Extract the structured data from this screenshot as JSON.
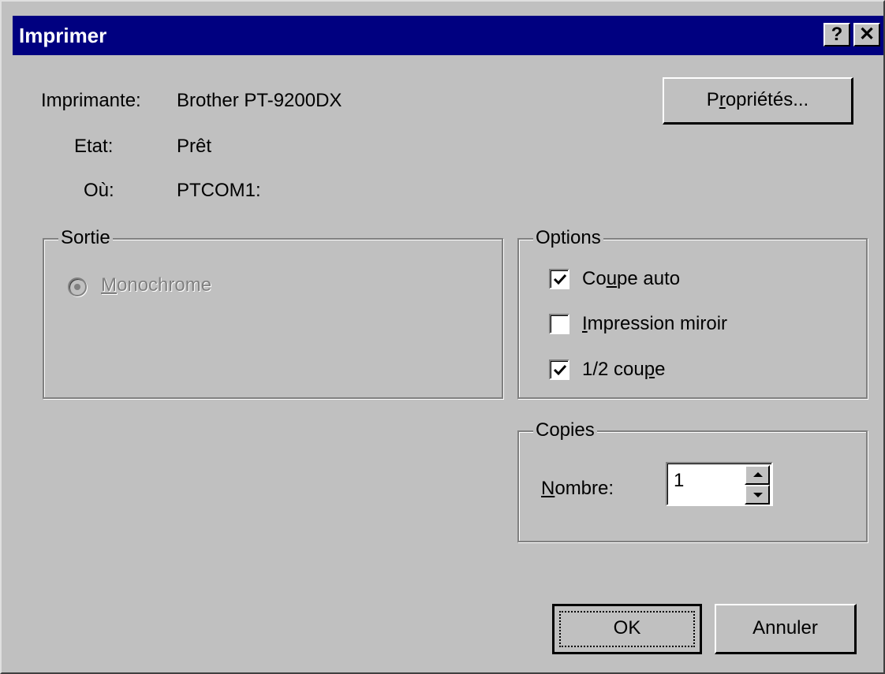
{
  "window": {
    "title": "Imprimer",
    "help_label": "?",
    "close_label": "✕"
  },
  "printer": {
    "printer_label": "Imprimante:",
    "printer_value": "Brother PT-9200DX",
    "status_label": "Etat:",
    "status_value": "Prêt",
    "where_label": "Où:",
    "where_value": "PTCOM1:",
    "properties_button": {
      "prefix": "P",
      "mnemonic": "r",
      "suffix": "opriétés..."
    }
  },
  "output": {
    "legend": "Sortie",
    "monochrome": {
      "mnemonic": "M",
      "rest": "onochrome",
      "selected": true,
      "enabled": false
    }
  },
  "options": {
    "legend": "Options",
    "items": [
      {
        "pre": "Co",
        "mnemonic": "u",
        "post": "pe auto",
        "checked": true
      },
      {
        "pre": "",
        "mnemonic": "I",
        "post": "mpression miroir",
        "checked": false
      },
      {
        "pre": "1/2 cou",
        "mnemonic": "p",
        "post": "e",
        "checked": true
      }
    ]
  },
  "copies": {
    "legend": "Copies",
    "label": {
      "mnemonic": "N",
      "rest": "ombre:"
    },
    "value": "1"
  },
  "buttons": {
    "ok": "OK",
    "cancel": "Annuler"
  }
}
